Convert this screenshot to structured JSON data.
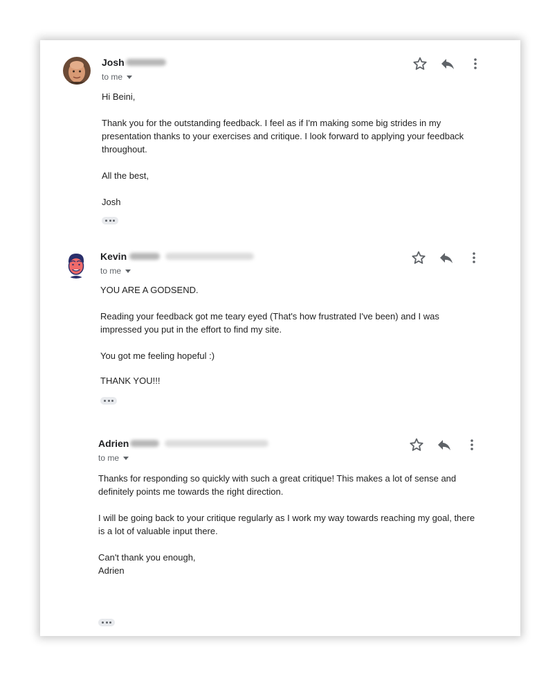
{
  "messages": [
    {
      "sender_first": "Josh",
      "recipient": "to me",
      "paragraphs": [
        "Hi Beini,",
        "Thank you for the outstanding feedback. I feel as if I'm making some big strides in my presentation thanks to your exercises and critique. I look forward to applying your feedback throughout.",
        "All the best,",
        "Josh"
      ]
    },
    {
      "sender_first": "Kevin",
      "recipient": "to me",
      "paragraphs": [
        "YOU ARE A GODSEND.",
        "Reading your feedback got me teary eyed (That's how frustrated I've been) and I was impressed you put in the effort to find my site.",
        "You got me feeling hopeful :)",
        "THANK YOU!!!"
      ]
    },
    {
      "sender_first": "Adrien",
      "recipient": "to me",
      "paragraphs": [
        "Thanks for responding so quickly with such a great critique! This makes a lot of sense and definitely points me towards the right direction.",
        "I will be going back to your critique regularly as I work my way towards reaching my goal, there is a lot of valuable input there.",
        "Can't thank you enough,\nAdrien"
      ]
    }
  ],
  "icons": {
    "star": "star-outline-icon",
    "reply": "reply-icon",
    "more": "more-vert-icon",
    "expand": "show-trimmed-content-icon"
  },
  "colors": {
    "text": "#222222",
    "secondary": "#5f6368",
    "sender": "#202124",
    "icon": "#5f6368"
  }
}
